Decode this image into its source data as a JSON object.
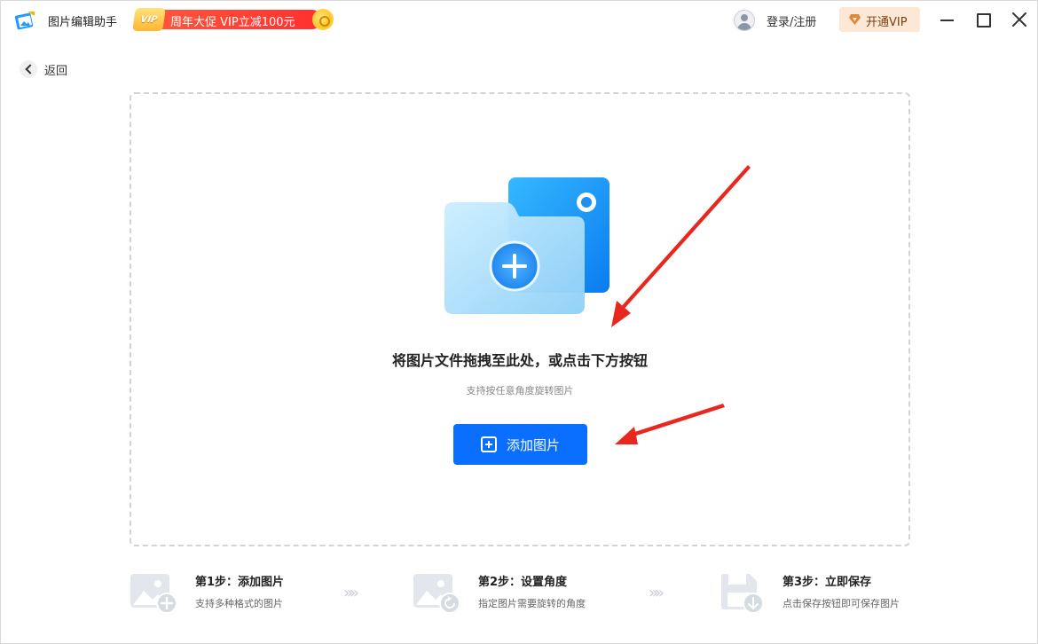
{
  "app": {
    "title": "图片编辑助手"
  },
  "promo": {
    "badge": "VIP",
    "text": "周年大促 VIP立减100元"
  },
  "header": {
    "login_label": "登录/注册",
    "vip_label": "开通VIP"
  },
  "nav": {
    "back_label": "返回"
  },
  "dropzone": {
    "title": "将图片文件拖拽至此处，或点击下方按钮",
    "subtitle": "支持按任意角度旋转图片",
    "add_button_label": "添加图片"
  },
  "steps": [
    {
      "title": "第1步：添加图片",
      "desc": "支持多种格式的图片",
      "icon": "image-add-icon"
    },
    {
      "title": "第2步：设置角度",
      "desc": "指定图片需要旋转的角度",
      "icon": "image-rotate-icon"
    },
    {
      "title": "第3步：立即保存",
      "desc": "点击保存按钮即可保存图片",
      "icon": "save-download-icon"
    }
  ],
  "colors": {
    "accent": "#0a6fff",
    "promo": "#ff3b30",
    "arrow": "#e8281f"
  }
}
